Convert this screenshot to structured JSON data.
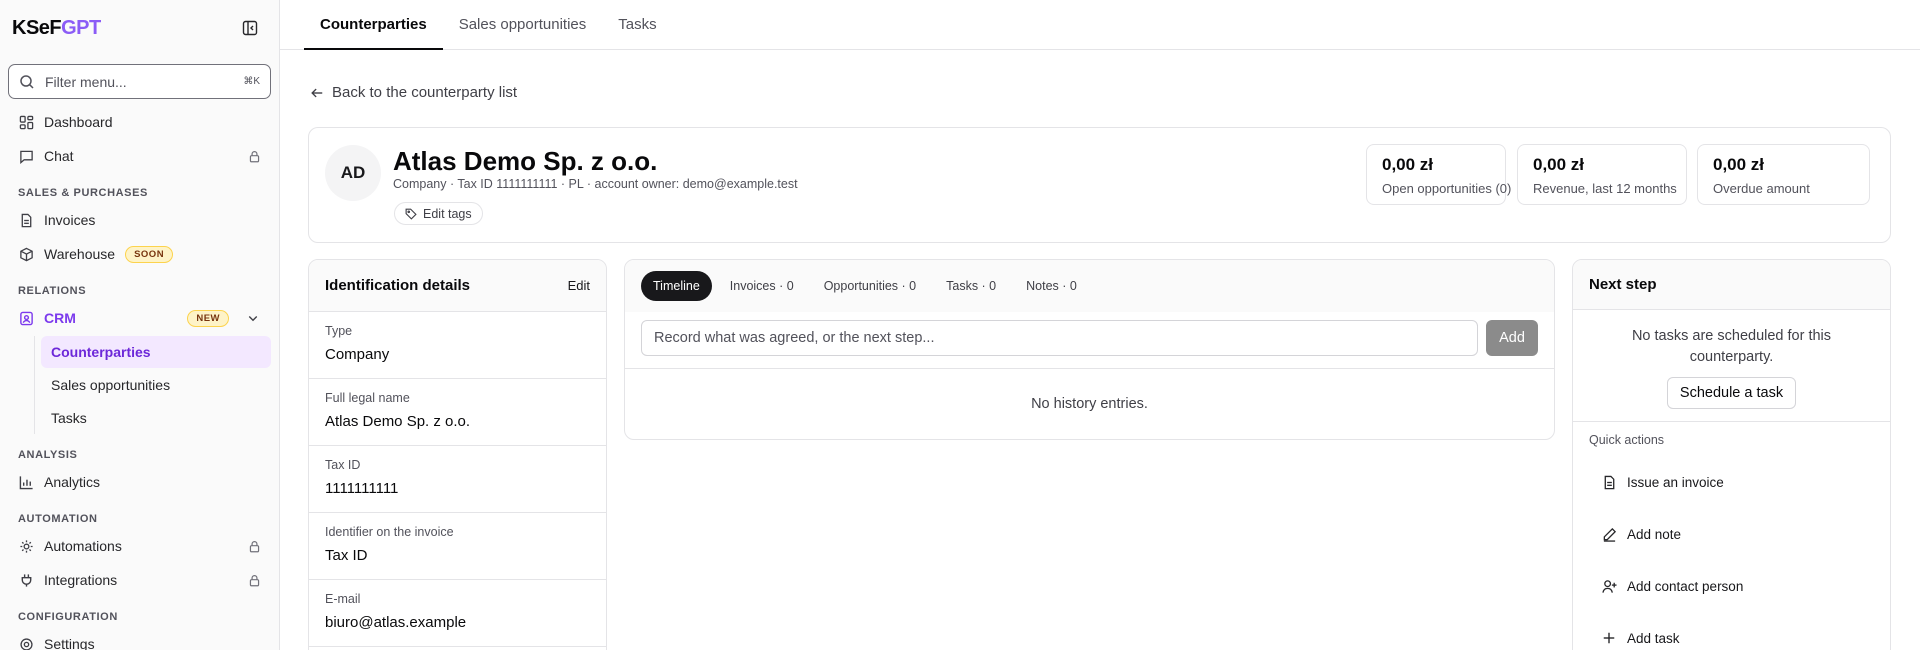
{
  "app": {
    "logo_main": "KSeF",
    "logo_accent": "GPT",
    "accent_color": "#8b5cf6"
  },
  "sidebar": {
    "search": {
      "placeholder": "Filter menu...",
      "shortcut": "⌘K"
    },
    "items": {
      "dashboard": "Dashboard",
      "chat": "Chat",
      "section_sales": "SALES & PURCHASES",
      "invoices": "Invoices",
      "warehouse": "Warehouse",
      "warehouse_badge": "SOON",
      "section_relations": "RELATIONS",
      "crm": "CRM",
      "crm_badge": "NEW",
      "counterparties": "Counterparties",
      "sales_opportunities": "Sales opportunities",
      "tasks": "Tasks",
      "section_analysis": "ANALYSIS",
      "analytics": "Analytics",
      "section_automation": "AUTOMATION",
      "automations": "Automations",
      "integrations": "Integrations",
      "section_configuration": "CONFIGURATION",
      "settings": "Settings"
    }
  },
  "tabs": [
    "Counterparties",
    "Sales opportunities",
    "Tasks"
  ],
  "back_link": "Back to the counterparty list",
  "company": {
    "initials": "AD",
    "name": "Atlas Demo Sp. z o.o.",
    "meta": "Company · Tax ID 1111111111 · PL · account owner: demo@example.test",
    "edit_tags": "Edit tags"
  },
  "stats": [
    {
      "value": "0,00 zł",
      "caption": "Open opportunities (0)"
    },
    {
      "value": "0,00 zł",
      "caption": "Revenue, last 12 months"
    },
    {
      "value": "0,00 zł",
      "caption": "Overdue amount"
    }
  ],
  "identification": {
    "title": "Identification details",
    "edit": "Edit",
    "fields": [
      {
        "label": "Type",
        "value": "Company"
      },
      {
        "label": "Full legal name",
        "value": "Atlas Demo Sp. z o.o."
      },
      {
        "label": "Tax ID",
        "value": "1111111111"
      },
      {
        "label": "Identifier on the invoice",
        "value": "Tax ID"
      },
      {
        "label": "E-mail",
        "value": "biuro@atlas.example"
      }
    ]
  },
  "timeline": {
    "tabs": [
      "Timeline",
      "Invoices · 0",
      "Opportunities · 0",
      "Tasks · 0",
      "Notes · 0"
    ],
    "input_placeholder": "Record what was agreed, or the next step...",
    "add_button": "Add",
    "empty": "No history entries."
  },
  "next_step": {
    "title": "Next step",
    "empty": "No tasks are scheduled for this counterparty.",
    "schedule_button": "Schedule a task",
    "quick_actions_label": "Quick actions",
    "actions": [
      "Issue an invoice",
      "Add note",
      "Add contact person",
      "Add task"
    ]
  }
}
